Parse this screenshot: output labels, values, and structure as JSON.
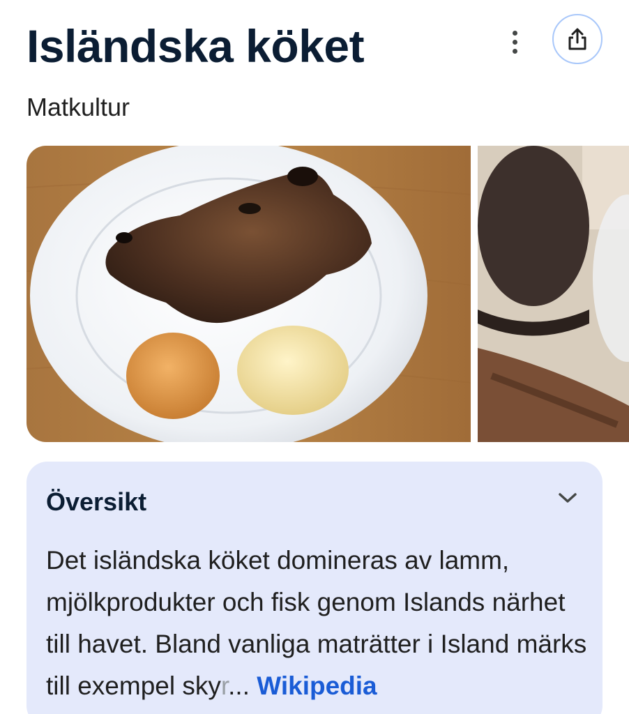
{
  "header": {
    "title": "Isländska köket",
    "subtitle": "Matkultur",
    "more_icon": "more-vert-icon",
    "share_icon": "share-icon"
  },
  "gallery": {
    "images": [
      {
        "subject": "svið-sheep-head-with-mash-plate"
      },
      {
        "subject": "blood-pudding-and-dried-fish-platter"
      }
    ]
  },
  "overview": {
    "heading": "Översikt",
    "text": "Det isländska köket domineras av lamm, mjölkprodukter och fisk genom Islands närhet till havet. Bland vanliga maträtter i Island märks till exempel sky",
    "fade_text": "r",
    "ellipsis": "...",
    "source_label": "Wikipedia",
    "expand_icon": "chevron-down-icon"
  },
  "colors": {
    "title": "#0b1d33",
    "card_background": "#e4e9fb",
    "link": "#1a5cd6",
    "share_border": "#a8c7fa"
  }
}
